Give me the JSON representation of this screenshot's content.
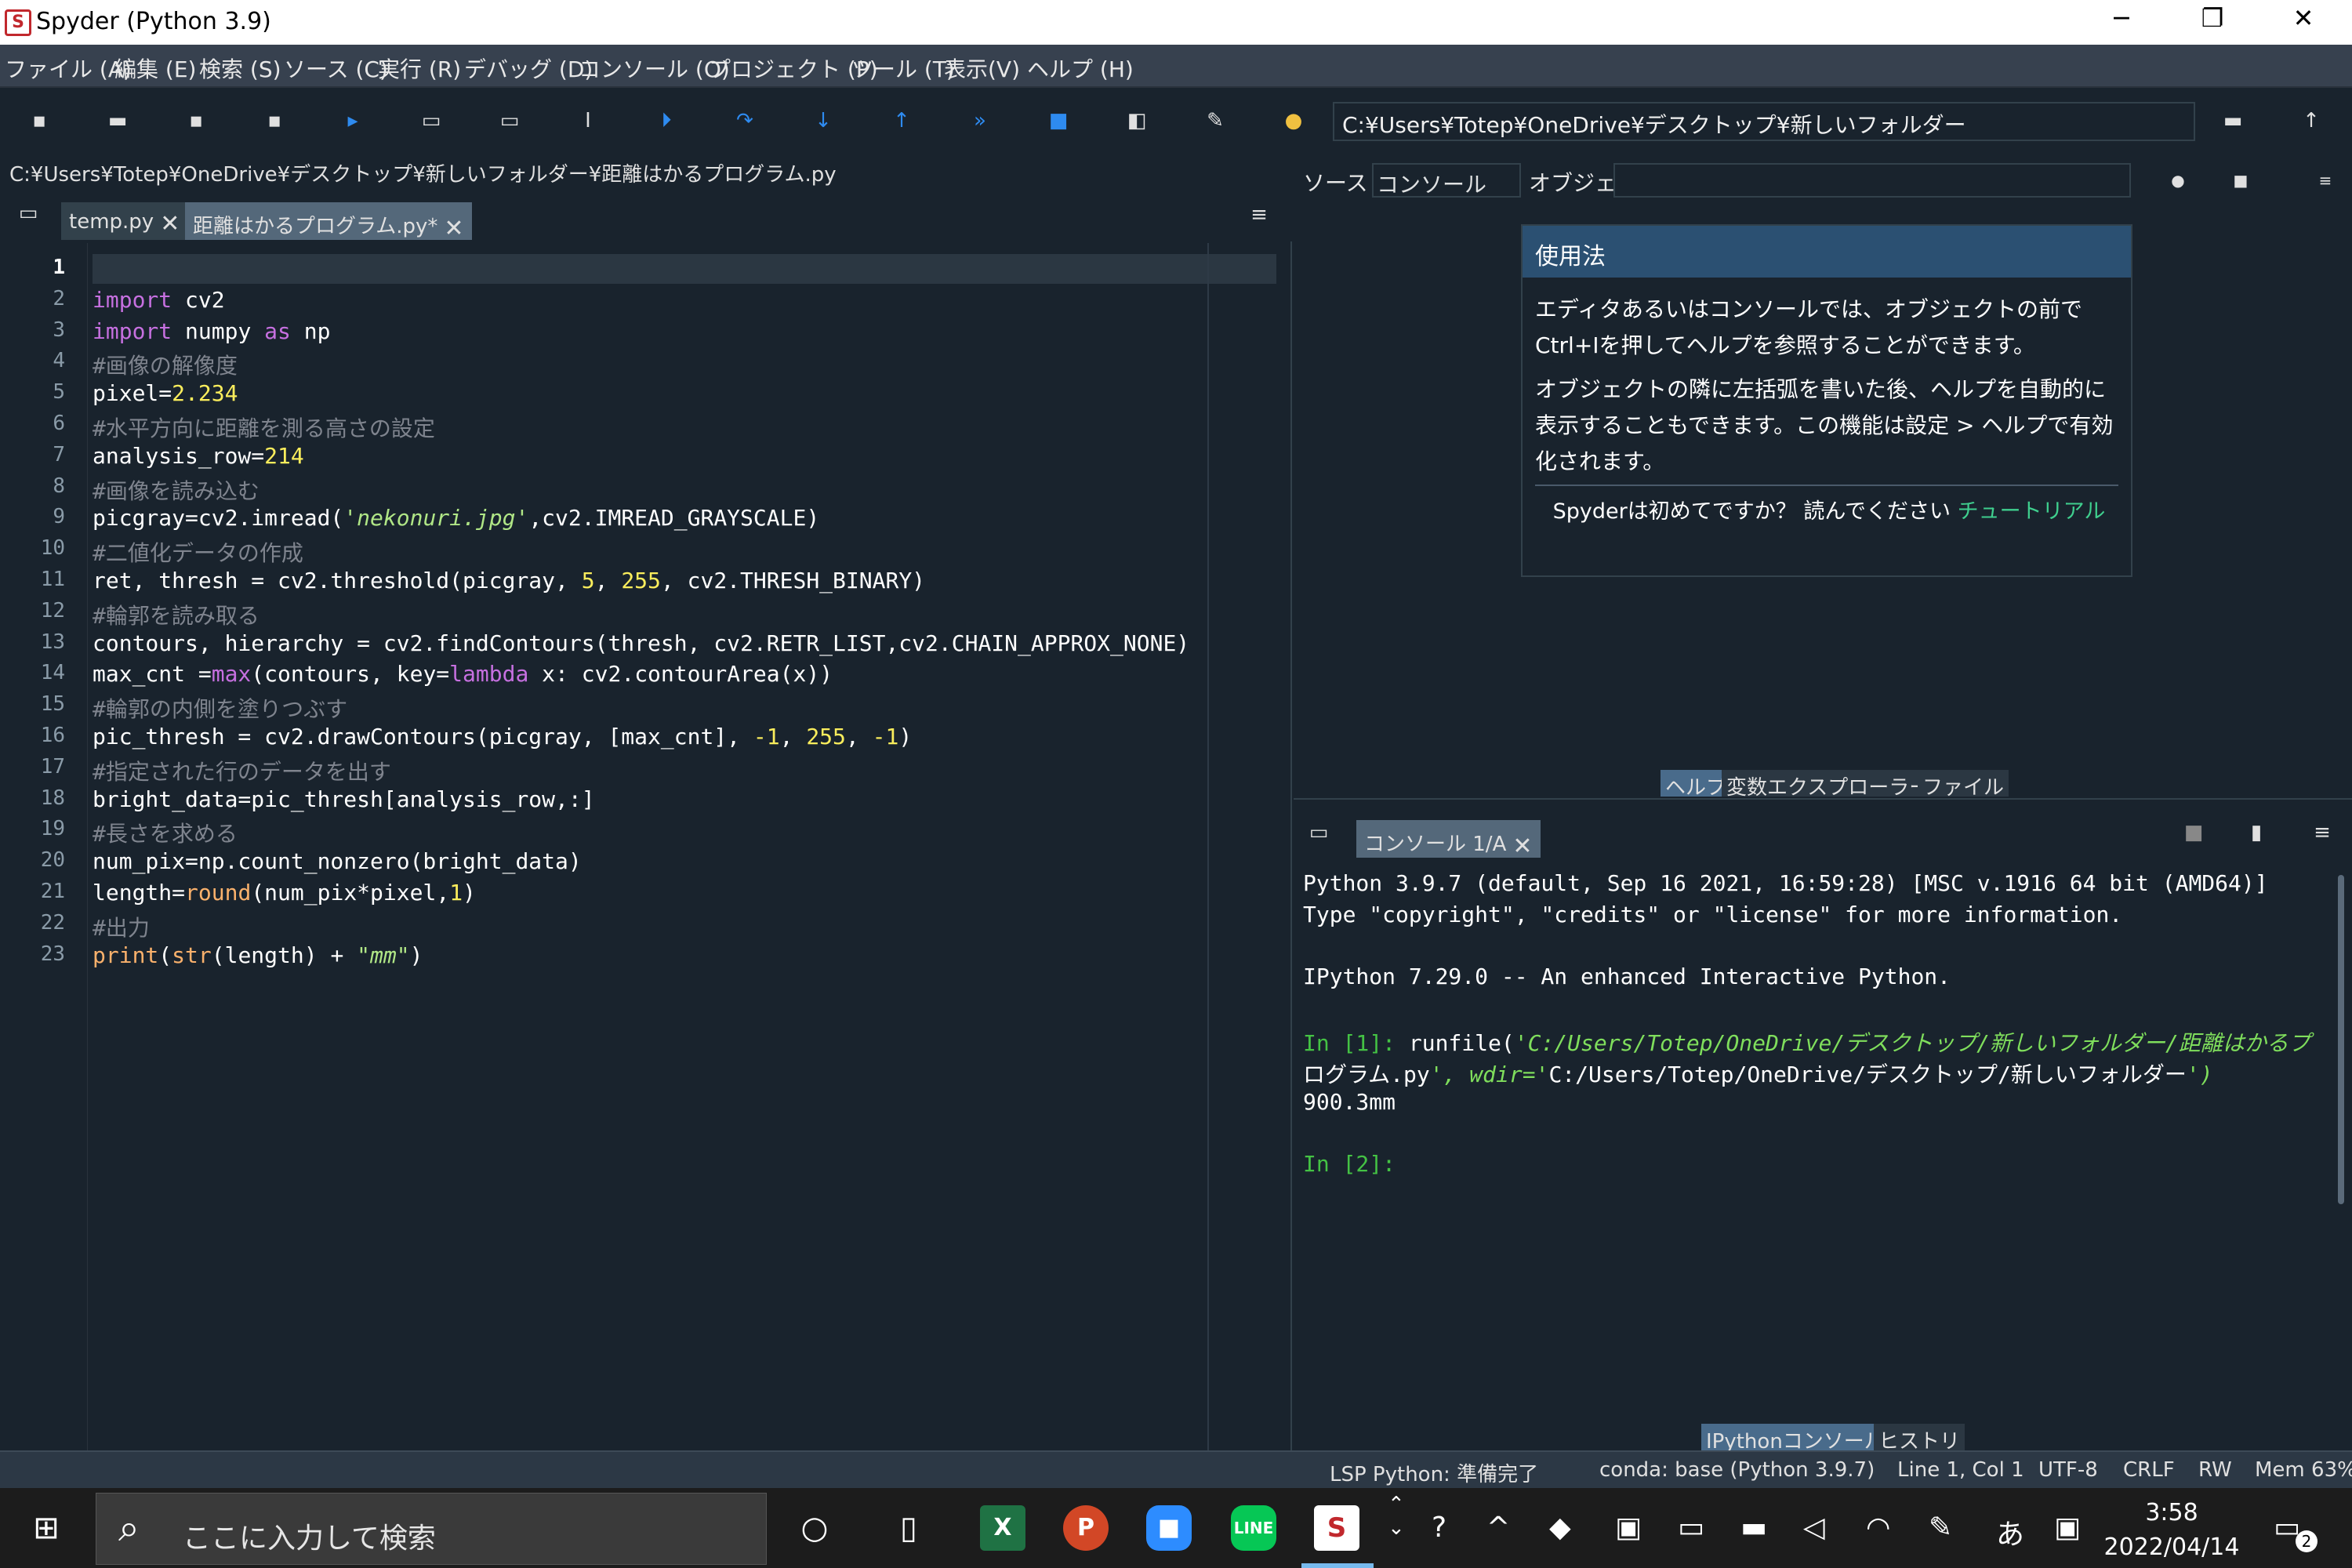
{
  "window": {
    "title": "Spyder (Python 3.9)",
    "minimize": "─",
    "maximize": "❐",
    "close": "✕"
  },
  "menu": [
    "ファイル (A)",
    "編集 (E)",
    "検索 (S)",
    "ソース (C)",
    "実行 (R)",
    "デバッグ (D)",
    "コンソール (O)",
    "プロジェクト (P)",
    "ツール (T)",
    "表示(V)",
    "ヘルプ (H)"
  ],
  "toolbar": {
    "working_dir": "C:¥Users¥Totep¥OneDrive¥デスクトップ¥新しいフォルダー"
  },
  "editor": {
    "file_path": "C:¥Users¥Totep¥OneDrive¥デスクトップ¥新しいフォルダー¥距離はかるプログラム.py",
    "tabs": [
      "temp.py",
      "距離はかるプログラム.py*"
    ],
    "line_numbers": [
      "1",
      "2",
      "3",
      "4",
      "5",
      "6",
      "7",
      "8",
      "9",
      "10",
      "11",
      "12",
      "13",
      "14",
      "15",
      "16",
      "17",
      "18",
      "19",
      "20",
      "21",
      "22",
      "23"
    ],
    "lines": [
      "",
      "import cv2",
      "import numpy as np",
      "#画像の解像度",
      "pixel=2.234",
      "#水平方向に距離を測る高さの設定",
      "analysis_row=214",
      "#画像を読み込む",
      "picgray=cv2.imread('nekonuri.jpg',cv2.IMREAD_GRAYSCALE)",
      "#二値化データの作成",
      "ret, thresh = cv2.threshold(picgray, 5, 255, cv2.THRESH_BINARY)",
      "#輪郭を読み取る",
      "contours, hierarchy = cv2.findContours(thresh, cv2.RETR_LIST,cv2.CHAIN_APPROX_NONE)",
      "max_cnt =max(contours, key=lambda x: cv2.contourArea(x))",
      "#輪郭の内側を塗りつぶす",
      "pic_thresh = cv2.drawContours(picgray, [max_cnt], -1, 255, -1)",
      "#指定された行のデータを出す",
      "bright_data=pic_thresh[analysis_row,:]",
      "#長さを求める",
      "num_pix=np.count_nonzero(bright_data)",
      "length=round(num_pix*pixel,1)",
      "#出力",
      "print(str(length) + \"mm\")"
    ]
  },
  "help": {
    "source_label": "ソース",
    "source_value": "コンソール",
    "object_label": "オブジェクト",
    "usage_title": "使用法",
    "para1": "エディタあるいはコンソールでは、オブジェクトの前でCtrl+Iを押してヘルプを参照することができます。",
    "para2": "オブジェクトの隣に左括弧を書いた後、ヘルプを自動的に表示することもできます。この機能は設定 > ヘルプで有効化されます。",
    "newbie": "Spyderは初めてですか？ 読んでください",
    "tutorial_link": "チュートリアル",
    "tabs": [
      "ヘルプ",
      "変数エクスプローラー",
      "ファイル"
    ]
  },
  "console": {
    "tab": "コンソール 1/A",
    "lines": [
      "Python 3.9.7 (default, Sep 16 2021, 16:59:28) [MSC v.1916 64 bit (AMD64)]",
      "Type \"copyright\", \"credits\" or \"license\" for more information.",
      "",
      "IPython 7.29.0 -- An enhanced Interactive Python.",
      "",
      "In [1]: runfile('C:/Users/Totep/OneDrive/デスクトップ/新しいフォルダー/距離はかるプ",
      "ログラム.py', wdir='C:/Users/Totep/OneDrive/デスクトップ/新しいフォルダー')",
      "900.3mm",
      "",
      "In [2]:"
    ],
    "tabs": [
      "IPythonコンソール",
      "ヒストリ"
    ]
  },
  "status": {
    "lsp": "LSP Python: 準備完了",
    "conda": "conda: base (Python 3.9.7)",
    "position": "Line 1, Col 1",
    "encoding": "UTF-8",
    "eol": "CRLF",
    "mode": "RW",
    "mem": "Mem 63%"
  },
  "taskbar": {
    "search_placeholder": "ここに入力して検索",
    "ime": "あ",
    "time": "3:58",
    "date": "2022/04/14",
    "notification_count": "2"
  }
}
